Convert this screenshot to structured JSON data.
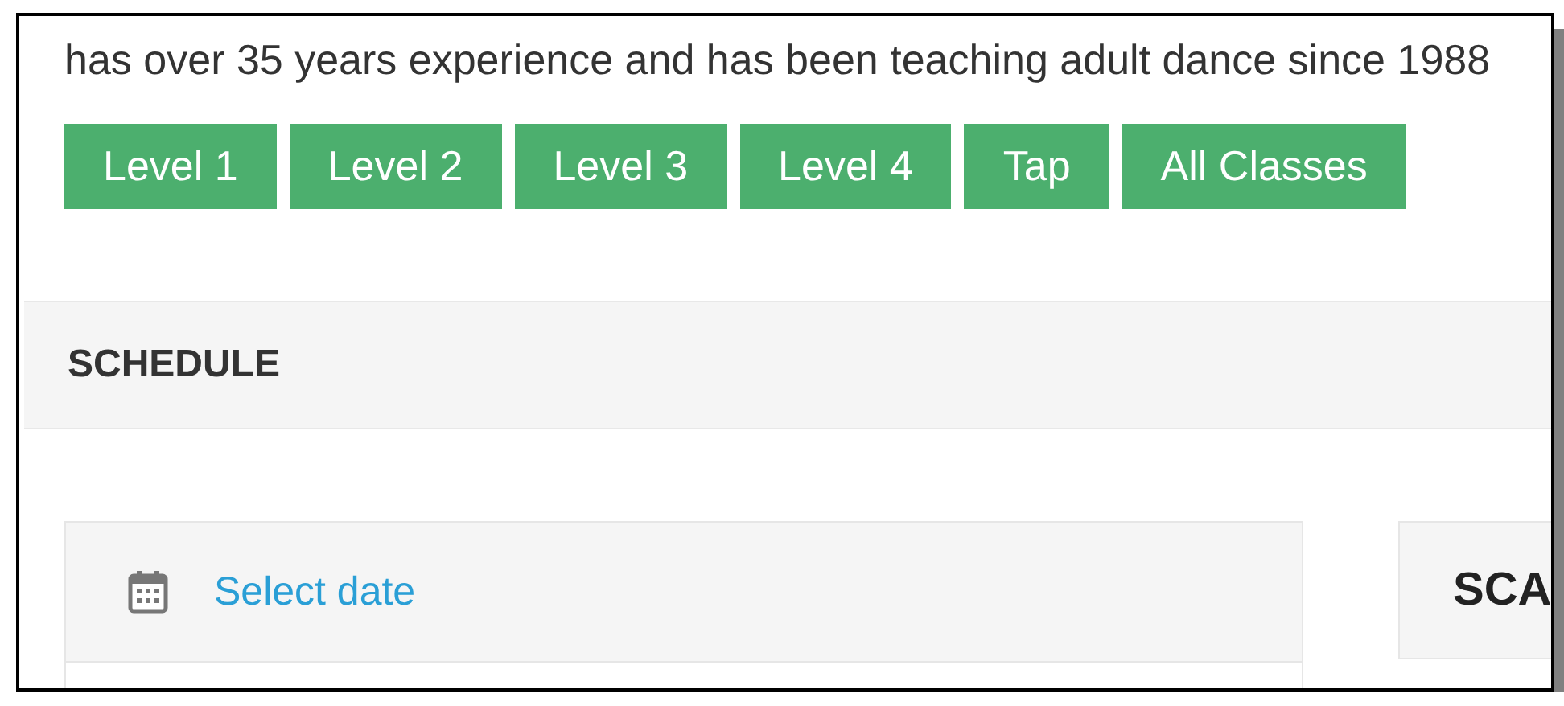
{
  "intro": "has over 35 years experience and has been teaching adult dance since 1988",
  "class_buttons": [
    "Level 1",
    "Level 2",
    "Level 3",
    "Level 4",
    "Tap",
    "All Classes"
  ],
  "section": {
    "title": "SCHEDULE"
  },
  "date_picker": {
    "label": "Select date"
  },
  "side_panel": {
    "title": "SCA"
  }
}
